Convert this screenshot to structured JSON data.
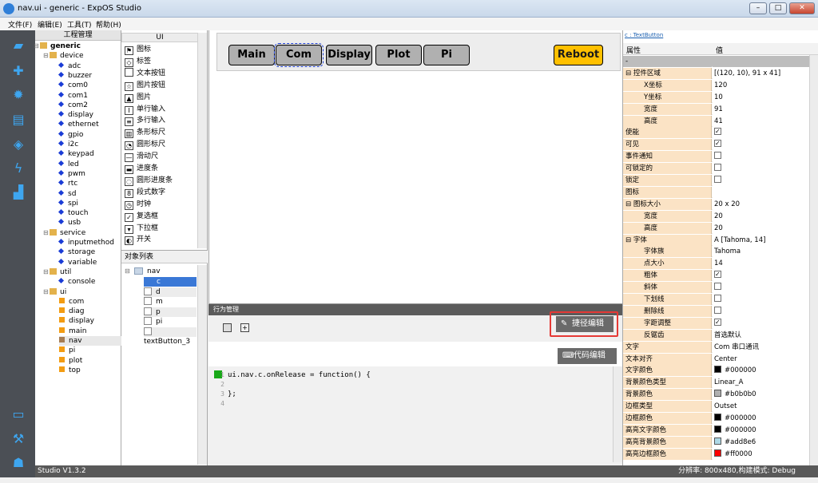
{
  "window": {
    "title": "nav.ui - generic - ExpOS Studio"
  },
  "menubar": [
    "文件(F)",
    "编辑(E)",
    "工具(T)",
    "帮助(H)"
  ],
  "tree": {
    "header": "工程管理",
    "items": [
      {
        "label": "generic",
        "type": "folder",
        "bold": true
      },
      {
        "label": "device",
        "type": "folder"
      },
      {
        "label": "adc",
        "type": "dot"
      },
      {
        "label": "buzzer",
        "type": "dot"
      },
      {
        "label": "com0",
        "type": "dot"
      },
      {
        "label": "com1",
        "type": "dot"
      },
      {
        "label": "com2",
        "type": "dot"
      },
      {
        "label": "display",
        "type": "dot"
      },
      {
        "label": "ethernet",
        "type": "dot"
      },
      {
        "label": "gpio",
        "type": "dot"
      },
      {
        "label": "i2c",
        "type": "dot"
      },
      {
        "label": "keypad",
        "type": "dot"
      },
      {
        "label": "led",
        "type": "dot"
      },
      {
        "label": "pwm",
        "type": "dot"
      },
      {
        "label": "rtc",
        "type": "dot"
      },
      {
        "label": "sd",
        "type": "dot"
      },
      {
        "label": "spi",
        "type": "dot"
      },
      {
        "label": "touch",
        "type": "dot"
      },
      {
        "label": "usb",
        "type": "dot"
      },
      {
        "label": "service",
        "type": "folder"
      },
      {
        "label": "inputmethod",
        "type": "dot"
      },
      {
        "label": "storage",
        "type": "dot"
      },
      {
        "label": "variable",
        "type": "dot"
      },
      {
        "label": "util",
        "type": "folder"
      },
      {
        "label": "console",
        "type": "dot"
      },
      {
        "label": "ui",
        "type": "folder"
      },
      {
        "label": "com",
        "type": "square"
      },
      {
        "label": "diag",
        "type": "square"
      },
      {
        "label": "display",
        "type": "square"
      },
      {
        "label": "main",
        "type": "square"
      },
      {
        "label": "nav",
        "type": "square",
        "selected": true
      },
      {
        "label": "pi",
        "type": "square"
      },
      {
        "label": "plot",
        "type": "square"
      },
      {
        "label": "top",
        "type": "square"
      }
    ]
  },
  "palette": {
    "header": "UI",
    "items": [
      {
        "label": "图标",
        "icon": "flag-icon"
      },
      {
        "label": "标签",
        "icon": "tag-icon"
      },
      {
        "label": "文本按钮",
        "icon": "text-button-icon"
      },
      {
        "label": "图片按钮",
        "icon": "star-button-icon"
      },
      {
        "label": "图片",
        "icon": "image-icon"
      },
      {
        "label": "单行输入",
        "icon": "single-line-input-icon"
      },
      {
        "label": "多行输入",
        "icon": "multi-line-input-icon"
      },
      {
        "label": "条形标尺",
        "icon": "bar-gauge-icon"
      },
      {
        "label": "圆形标尺",
        "icon": "round-gauge-icon"
      },
      {
        "label": "滑动尺",
        "icon": "slider-icon"
      },
      {
        "label": "进度条",
        "icon": "progress-bar-icon"
      },
      {
        "label": "圆形进度条",
        "icon": "round-progress-icon"
      },
      {
        "label": "段式数字",
        "icon": "segment-digit-icon"
      },
      {
        "label": "时钟",
        "icon": "clock-icon"
      },
      {
        "label": "复选框",
        "icon": "checkbox-icon"
      },
      {
        "label": "下拉框",
        "icon": "dropdown-icon"
      },
      {
        "label": "开关",
        "icon": "toggle-icon"
      }
    ]
  },
  "objects": {
    "header": "对象列表",
    "root": "nav",
    "items": [
      "c",
      "d",
      "m",
      "p",
      "pi",
      "textButton_3"
    ]
  },
  "canvas": {
    "buttons": [
      "Main",
      "Com",
      "Display",
      "Plot",
      "Pi"
    ],
    "reboot": "Reboot"
  },
  "action": {
    "title": "行为管理",
    "shortcut_label": "捷径编辑",
    "code_label": "代码编辑"
  },
  "code": {
    "lines": [
      "ui.nav.c.onRelease = function() {",
      "",
      "};",
      ""
    ],
    "line_numbers": [
      "1",
      "2",
      "3",
      "4"
    ]
  },
  "props": {
    "tab": "c : TextButton",
    "col_key": "属性",
    "col_val": "值",
    "rows": [
      {
        "key": "-",
        "val": ""
      },
      {
        "key": "⊟ 控件区域",
        "val": "[(120, 10), 91 x 41]"
      },
      {
        "key": "X坐标",
        "val": "120",
        "indent": true
      },
      {
        "key": "Y坐标",
        "val": "10",
        "indent": true
      },
      {
        "key": "宽度",
        "val": "91",
        "indent": true
      },
      {
        "key": "高度",
        "val": "41",
        "indent": true
      },
      {
        "key": "使能",
        "cb": true
      },
      {
        "key": "可见",
        "cb": true
      },
      {
        "key": "事件通知",
        "cb": false
      },
      {
        "key": "可锁定的",
        "cb": false
      },
      {
        "key": "锁定",
        "cb": false
      },
      {
        "key": "图标",
        "val": ""
      },
      {
        "key": "⊟ 图标大小",
        "val": "20 x 20"
      },
      {
        "key": "宽度",
        "val": "20",
        "indent": true
      },
      {
        "key": "高度",
        "val": "20",
        "indent": true
      },
      {
        "key": "⊟ 字体",
        "val": "A [Tahoma, 14]"
      },
      {
        "key": "字体族",
        "val": "Tahoma",
        "indent": true
      },
      {
        "key": "点大小",
        "val": "14",
        "indent": true
      },
      {
        "key": "粗体",
        "cb": true,
        "indent": true
      },
      {
        "key": "斜体",
        "cb": false,
        "indent": true
      },
      {
        "key": "下划线",
        "cb": false,
        "indent": true
      },
      {
        "key": "删除线",
        "cb": false,
        "indent": true
      },
      {
        "key": "字距调整",
        "cb": true,
        "indent": true
      },
      {
        "key": "反锯齿",
        "val": "首选默认",
        "indent": true
      },
      {
        "key": "文字",
        "val": "Com 串口通讯"
      },
      {
        "key": "文本对齐",
        "val": "Center"
      },
      {
        "key": "文字颜色",
        "val": "#000000",
        "swatch": "#000000"
      },
      {
        "key": "背景颜色类型",
        "val": "Linear_A"
      },
      {
        "key": "背景颜色",
        "val": "#b0b0b0",
        "swatch": "#b0b0b0"
      },
      {
        "key": "边框类型",
        "val": "Outset"
      },
      {
        "key": "边框颜色",
        "val": "#000000",
        "swatch": "#000000"
      },
      {
        "key": "高亮文字颜色",
        "val": "#000000",
        "swatch": "#000000"
      },
      {
        "key": "高亮背景颜色",
        "val": "#add8e6",
        "swatch": "#add8e6"
      },
      {
        "key": "高亮边框颜色",
        "val": "#ff0000",
        "swatch": "#ff0000"
      }
    ]
  },
  "status": {
    "version": "Studio V1.3.2",
    "info": "分辨率: 800x480,构建模式: Debug"
  },
  "colors": {
    "accent": "#3ea6f0",
    "reboot": "#ffc000",
    "highlight_red": "#e53935"
  }
}
